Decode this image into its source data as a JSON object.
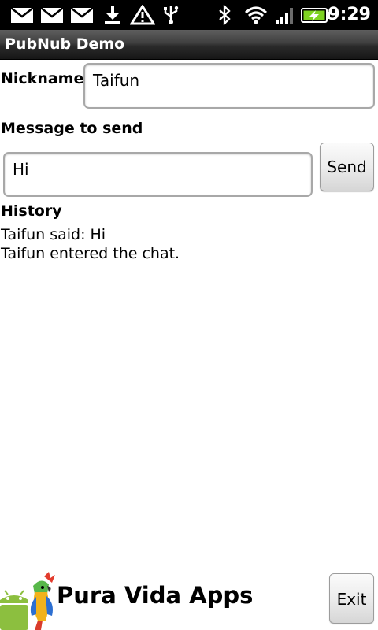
{
  "status_bar": {
    "icons": [
      "mail-icon",
      "mail-icon",
      "mail-icon",
      "download-icon",
      "warning-icon",
      "usb-icon",
      "bluetooth-icon",
      "wifi-icon",
      "signal-icon",
      "battery-charging-icon"
    ],
    "time": "9:29"
  },
  "app": {
    "title": "PubNub Demo"
  },
  "form": {
    "nickname_label": "Nickname",
    "nickname_value": "Taifun",
    "message_label": "Message to send",
    "message_value": "Hi",
    "send_label": "Send"
  },
  "history": {
    "title": "History",
    "lines": [
      "Taifun said: Hi",
      "Taifun entered the chat."
    ]
  },
  "footer": {
    "brand": "Pura Vida Apps",
    "exit_label": "Exit"
  },
  "colors": {
    "status_bar_bg": "#000000",
    "title_bar_bg": "#2b2b2b",
    "battery_fill": "#7ed321"
  }
}
